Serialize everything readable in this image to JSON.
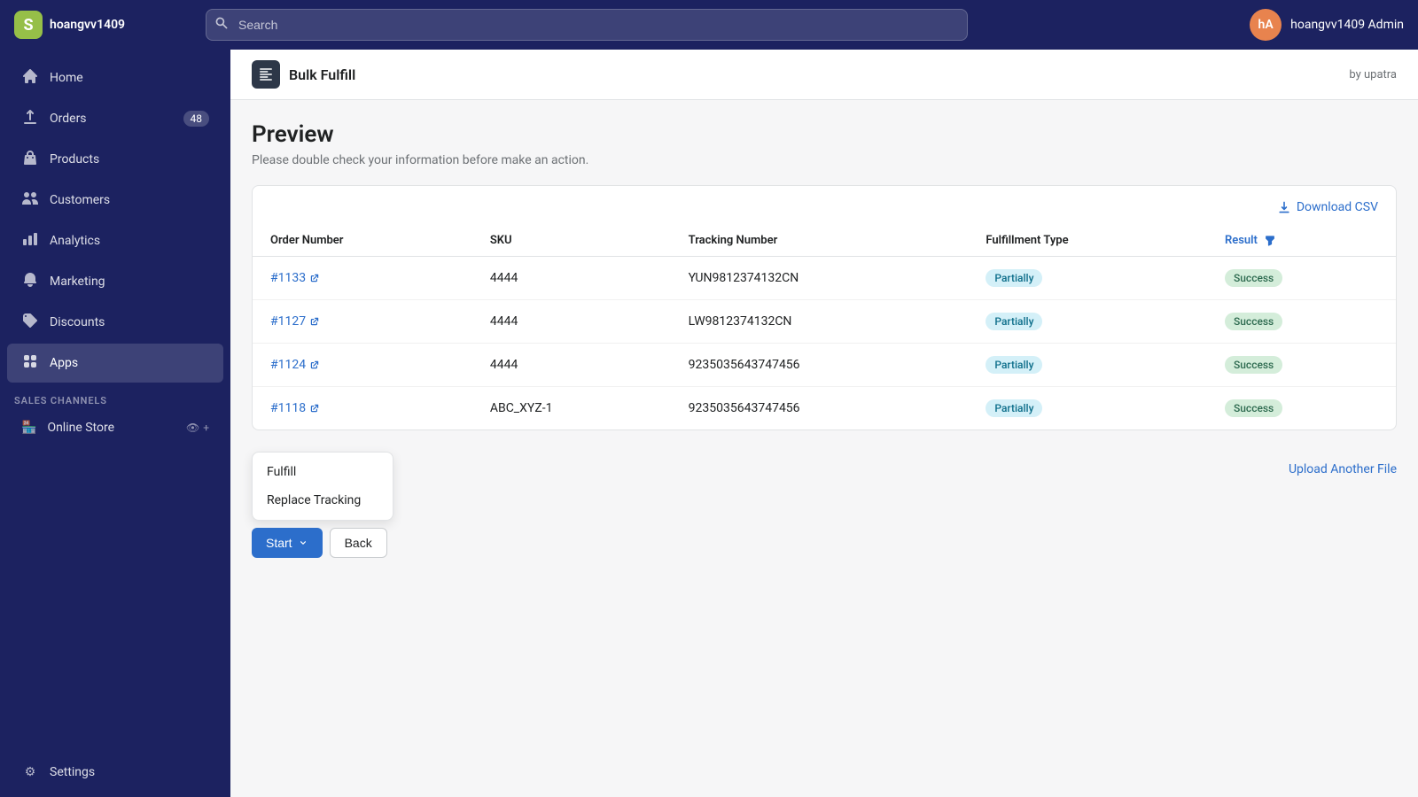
{
  "topnav": {
    "brand": "hoangvv1409",
    "search_placeholder": "Search",
    "user_initials": "hA",
    "user_name": "hoangvv1409 Admin"
  },
  "sidebar": {
    "items": [
      {
        "id": "home",
        "label": "Home",
        "icon": "⌂",
        "badge": null
      },
      {
        "id": "orders",
        "label": "Orders",
        "icon": "↓",
        "badge": "48"
      },
      {
        "id": "products",
        "label": "Products",
        "icon": "◻",
        "badge": null
      },
      {
        "id": "customers",
        "label": "Customers",
        "icon": "👤",
        "badge": null
      },
      {
        "id": "analytics",
        "label": "Analytics",
        "icon": "📊",
        "badge": null
      },
      {
        "id": "marketing",
        "label": "Marketing",
        "icon": "📢",
        "badge": null
      },
      {
        "id": "discounts",
        "label": "Discounts",
        "icon": "🏷",
        "badge": null
      },
      {
        "id": "apps",
        "label": "Apps",
        "icon": "⊞",
        "badge": null
      }
    ],
    "sales_channels_label": "SALES CHANNELS",
    "sales_channels": [
      {
        "id": "online-store",
        "label": "Online Store"
      }
    ],
    "bottom_items": [
      {
        "id": "settings",
        "label": "Settings",
        "icon": "⚙"
      }
    ]
  },
  "app_header": {
    "title": "Bulk Fulfill",
    "by_text": "by upatra"
  },
  "page": {
    "title": "Preview",
    "subtitle": "Please double check your information before make an action."
  },
  "table": {
    "download_csv_label": "Download CSV",
    "columns": [
      {
        "key": "order_number",
        "label": "Order Number"
      },
      {
        "key": "sku",
        "label": "SKU"
      },
      {
        "key": "tracking_number",
        "label": "Tracking Number"
      },
      {
        "key": "fulfillment_type",
        "label": "Fulfillment Type"
      },
      {
        "key": "result",
        "label": "Result"
      }
    ],
    "rows": [
      {
        "order_number": "#1133",
        "sku": "4444",
        "tracking_number": "YUN9812374132CN",
        "fulfillment_type": "Partially",
        "result": "Success"
      },
      {
        "order_number": "#1127",
        "sku": "4444",
        "tracking_number": "LW9812374132CN",
        "fulfillment_type": "Partially",
        "result": "Success"
      },
      {
        "order_number": "#1124",
        "sku": "4444",
        "tracking_number": "9235035643747456",
        "fulfillment_type": "Partially",
        "result": "Success"
      },
      {
        "order_number": "#1118",
        "sku": "ABC_XYZ-1",
        "tracking_number": "9235035643747456",
        "fulfillment_type": "Partially",
        "result": "Success"
      }
    ]
  },
  "actions": {
    "dropdown_items": [
      {
        "label": "Fulfill"
      },
      {
        "label": "Replace Tracking"
      }
    ],
    "start_label": "Start",
    "back_label": "Back",
    "upload_label": "Upload Another File"
  }
}
